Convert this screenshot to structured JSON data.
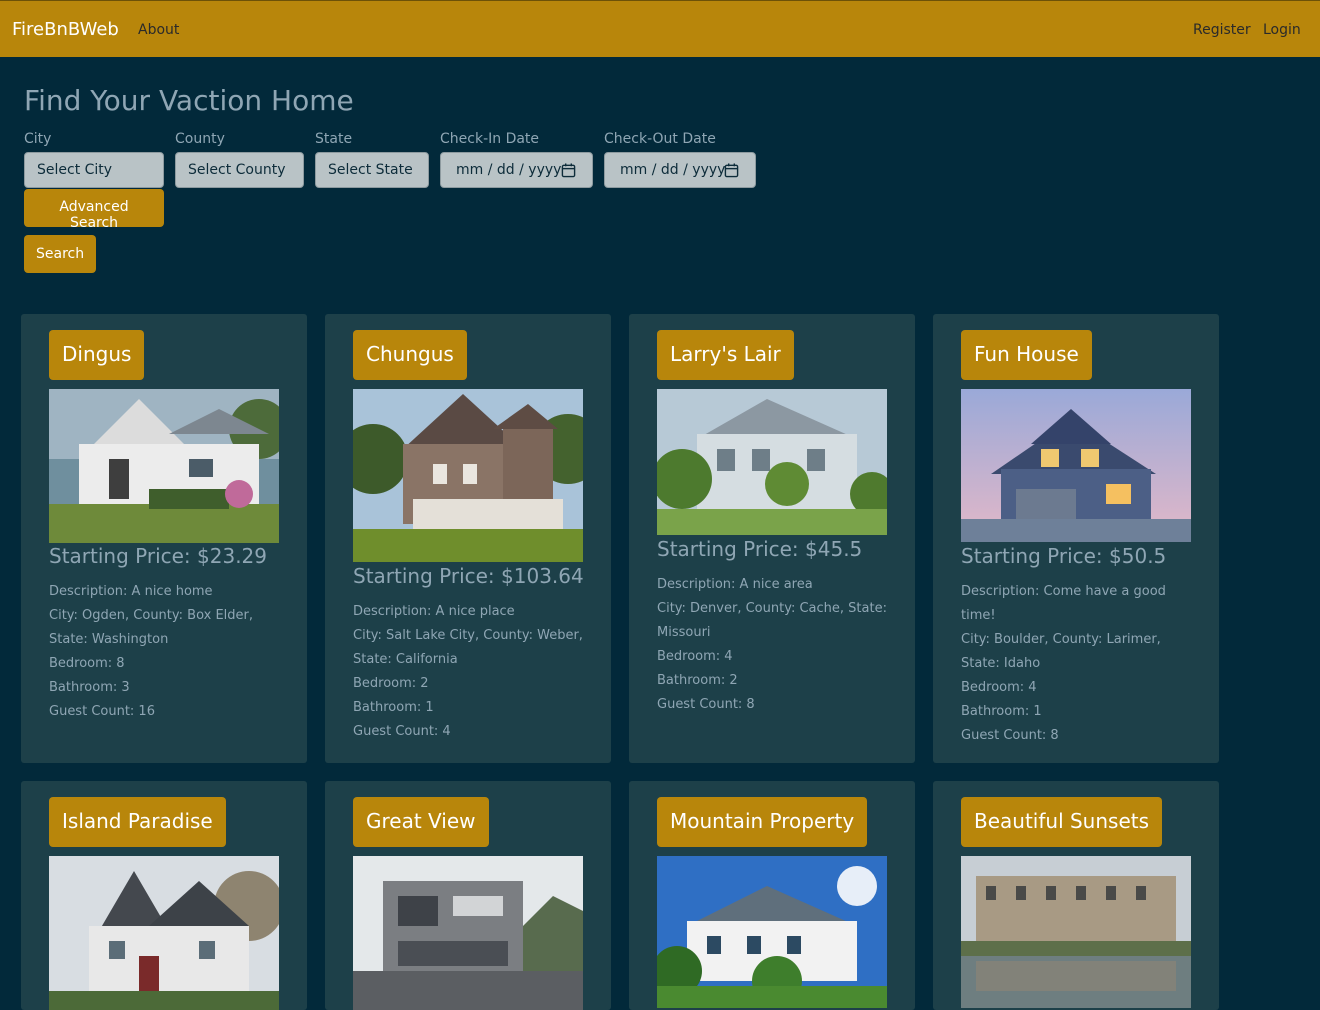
{
  "nav": {
    "brand": "FireBnBWeb",
    "about": "About",
    "register": "Register",
    "login": "Login"
  },
  "page_title": "Find Your Vaction Home",
  "filters": {
    "city": {
      "label": "City",
      "placeholder": "Select City"
    },
    "county": {
      "label": "County",
      "placeholder": "Select County"
    },
    "state": {
      "label": "State",
      "placeholder": "Select State"
    },
    "checkin": {
      "label": "Check-In Date",
      "placeholder": "mm / dd / yyyy"
    },
    "checkout": {
      "label": "Check-Out Date",
      "placeholder": "mm / dd / yyyy"
    }
  },
  "buttons": {
    "advanced_search": "Advanced Search",
    "search": "Search"
  },
  "colors": {
    "accent": "#b8860b",
    "background": "#02293a",
    "card": "#1d4049",
    "text": "#8fa6b4"
  },
  "listings": [
    {
      "name": "Dingus",
      "price": "Starting Price: $23.29",
      "description": "Description: A nice home",
      "location": "City: Ogden, County: Box Elder, State: Washington",
      "bedroom": "Bedroom: 8",
      "bathroom": "Bathroom: 3",
      "guests": "Guest Count: 16"
    },
    {
      "name": "Chungus",
      "price": "Starting Price: $103.64",
      "description": "Description: A nice place",
      "location": "City: Salt Lake City, County: Weber, State: California",
      "bedroom": "Bedroom: 2",
      "bathroom": "Bathroom: 1",
      "guests": "Guest Count: 4"
    },
    {
      "name": "Larry's Lair",
      "price": "Starting Price: $45.5",
      "description": "Description: A nice area",
      "location": "City: Denver, County: Cache, State: Missouri",
      "bedroom": "Bedroom: 4",
      "bathroom": "Bathroom: 2",
      "guests": "Guest Count: 8"
    },
    {
      "name": "Fun House",
      "price": "Starting Price: $50.5",
      "description": "Description: Come have a good time!",
      "location": "City: Boulder, County: Larimer, State: Idaho",
      "bedroom": "Bedroom: 4",
      "bathroom": "Bathroom: 1",
      "guests": "Guest Count: 8"
    },
    {
      "name": "Island Paradise"
    },
    {
      "name": "Great View"
    },
    {
      "name": "Mountain Property"
    },
    {
      "name": "Beautiful Sunsets"
    }
  ]
}
